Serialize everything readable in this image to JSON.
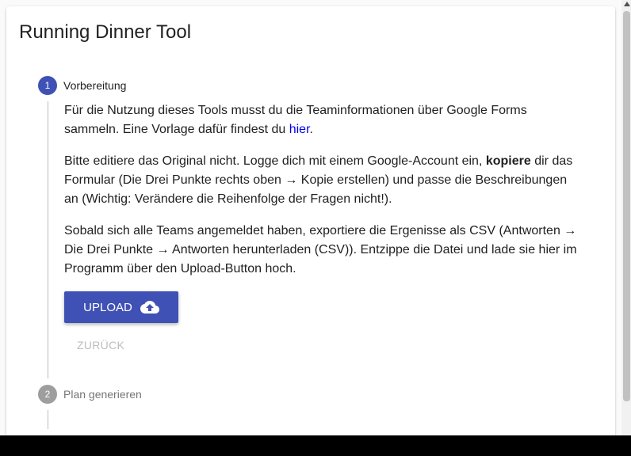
{
  "app": {
    "title": "Running Dinner Tool"
  },
  "steps": [
    {
      "number": "1",
      "label": "Vorbereitung",
      "state": "active"
    },
    {
      "number": "2",
      "label": "Plan generieren",
      "state": "inactive"
    }
  ],
  "content": {
    "p1_text": "Für die Nutzung dieses Tools musst du die Teaminformationen über Google Forms sammeln. Eine Vorlage dafür findest du ",
    "p1_link": "hier",
    "p1_end": ".",
    "p2_before": "Bitte editiere das Original nicht. Logge dich mit einem Google-Account ein, ",
    "p2_bold": "kopiere",
    "p2_after": " dir das Formular (Die Drei Punkte rechts oben → Kopie erstellen) und passe die Beschreibungen an (Wichtig: Verändere die Reihenfolge der Fragen nicht!).",
    "p3": "Sobald sich alle Teams angemeldet haben, exportiere die Ergenisse als CSV (Antworten → Die Drei Punkte → Antworten herunterladen (CSV)). Entzippe die Datei und lade sie hier im Programm über den Upload-Button hoch."
  },
  "buttons": {
    "upload_label": "UPLOAD",
    "upload_icon": "cloud-upload-icon",
    "back_label": "ZURÜCK"
  },
  "colors": {
    "accent": "#3f51b5",
    "link": "#0000ee",
    "inactive": "#9e9e9e"
  }
}
